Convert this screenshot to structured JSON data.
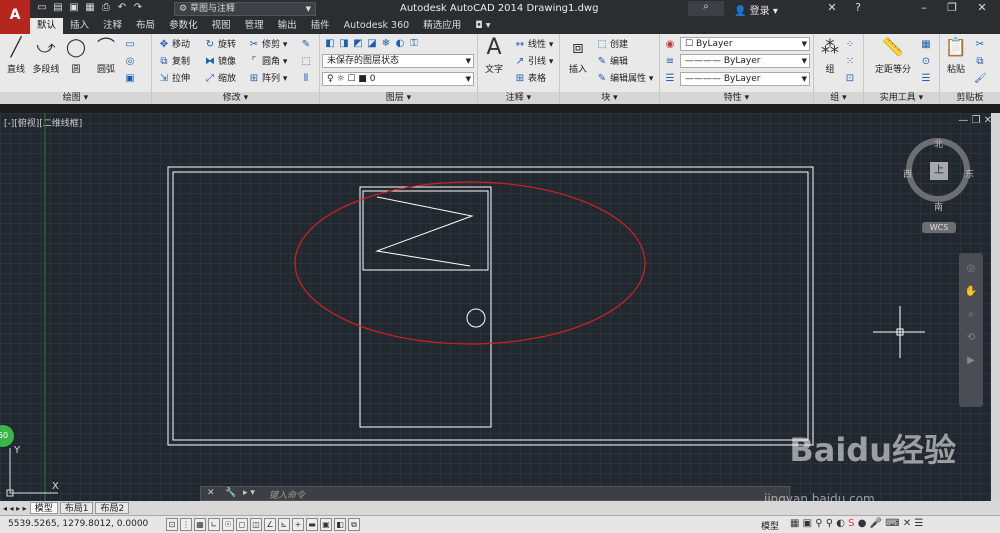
{
  "app": {
    "logo_letter": "A",
    "window_title": "Autodesk AutoCAD 2014    Drawing1.dwg",
    "workspace": "草图与注释",
    "login": "登录",
    "search_placeholder": ""
  },
  "tabs": [
    "默认",
    "插入",
    "注释",
    "布局",
    "参数化",
    "视图",
    "管理",
    "输出",
    "插件",
    "Autodesk 360",
    "精选应用"
  ],
  "ribbon": {
    "draw": {
      "title": "绘图",
      "tools": [
        "直线",
        "多段线",
        "圆",
        "圆弧"
      ]
    },
    "modify": {
      "title": "修改",
      "tools": [
        "移动",
        "旋转",
        "修剪",
        "复制",
        "镜像",
        "圆角",
        "拉伸",
        "缩放",
        "阵列"
      ]
    },
    "layers": {
      "title": "图层",
      "state": "未保存的图层状态",
      "current": "0"
    },
    "annotation": {
      "title": "注释",
      "text": "文字",
      "tools": [
        "线性",
        "引线",
        "表格"
      ]
    },
    "block": {
      "title": "块",
      "insert": "插入",
      "tools": [
        "创建",
        "编辑",
        "编辑属性"
      ]
    },
    "properties": {
      "title": "特性",
      "color": "ByLayer",
      "linetype": "ByLayer",
      "lineweight": "ByLayer"
    },
    "groups": {
      "title": "组",
      "tool": "组"
    },
    "utilities": {
      "title": "实用工具",
      "tool": "定距等分"
    },
    "clipboard": {
      "title": "剪贴板",
      "tool": "粘贴"
    }
  },
  "viewport": {
    "label": "[-][俯视][二维线框]",
    "viewcube": {
      "top": "上",
      "north": "北",
      "south": "南",
      "east": "东",
      "west": "西"
    },
    "wcs": "WCS",
    "ucs_y": "Y",
    "ucs_x": "X",
    "badge": "60"
  },
  "command": {
    "placeholder": "键入命令"
  },
  "layout_tabs": [
    "模型",
    "布局1",
    "布局2"
  ],
  "status": {
    "coords": "5539.5265, 1279.8012, 0.0000",
    "model": "模型"
  },
  "watermark": {
    "brand": "Baidu经验",
    "url": "jingyan.baidu.com"
  },
  "colors": {
    "drawing_bg": "#212830",
    "ellipse": "#d42020",
    "lines": "#ffffff"
  }
}
